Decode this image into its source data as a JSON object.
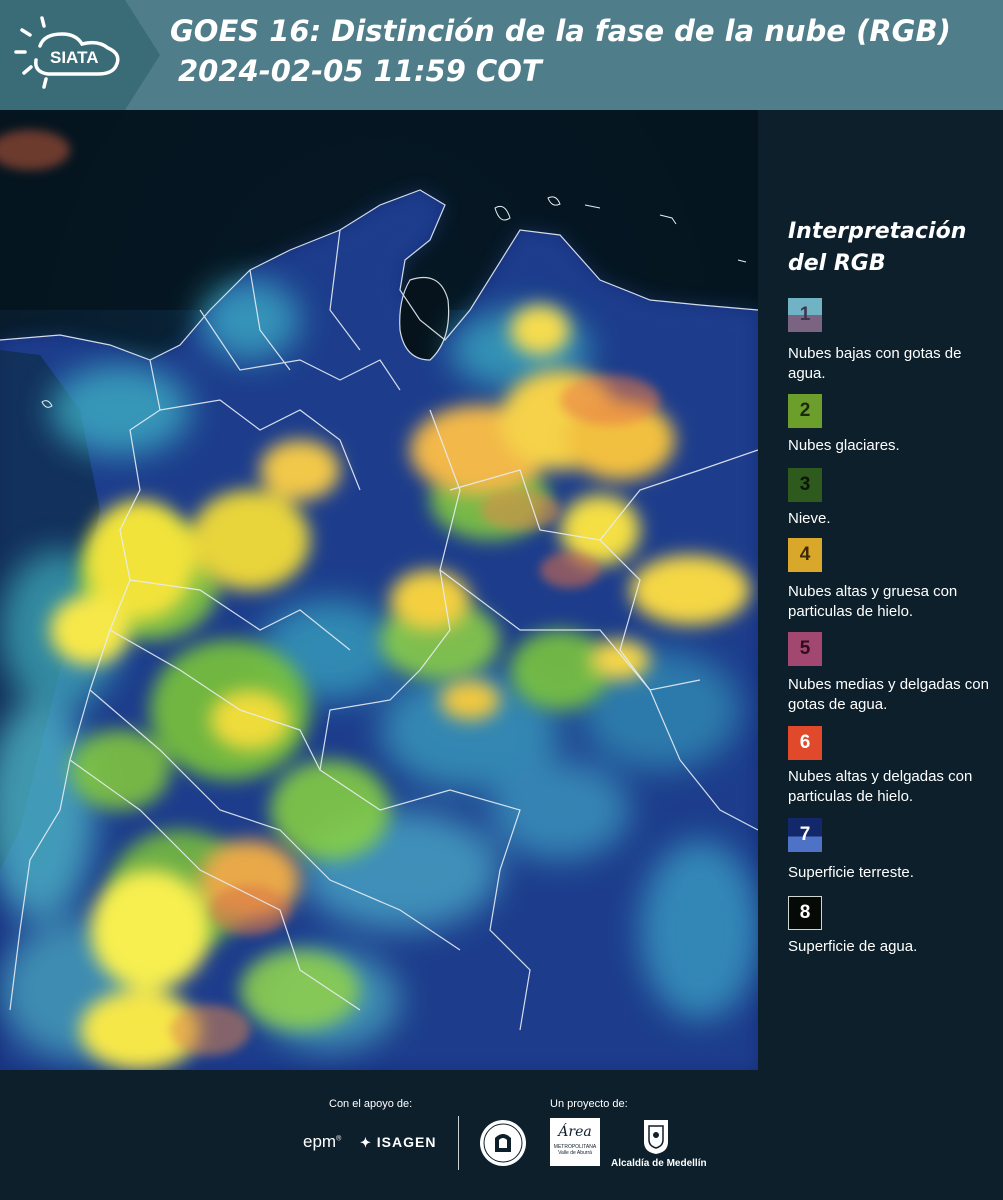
{
  "header": {
    "logo_text": "SIATA",
    "title_line1": "GOES 16: Distinción de la fase de la nube (RGB)",
    "title_line2": "2024-02-05 11:59 COT"
  },
  "legend": {
    "title": "Interpretación del RGB",
    "items": [
      {
        "number": "1",
        "label": "Nubes bajas con gotas de agua.",
        "color_top": "#6fb3c4",
        "color_bottom": "#7a6482"
      },
      {
        "number": "2",
        "label": "Nubes glaciares.",
        "color": "#6c9e2b"
      },
      {
        "number": "3",
        "label": "Nieve.",
        "color": "#2e5a1d"
      },
      {
        "number": "4",
        "label": "Nubes altas y gruesa con particulas de hielo.",
        "color": "#d9a82a"
      },
      {
        "number": "5",
        "label": "Nubes medias y delgadas con gotas de agua.",
        "color": "#a2476f"
      },
      {
        "number": "6",
        "label": "Nubes altas y delgadas con particulas de hielo.",
        "color": "#e04a2a"
      },
      {
        "number": "7",
        "label": "Superficie terreste.",
        "color_top": "#13286a",
        "color_bottom": "#4e73c6"
      },
      {
        "number": "8",
        "label": "Superficie de agua.",
        "color": "#050a07"
      }
    ]
  },
  "footer": {
    "support_label": "Con el apoyo de:",
    "project_label": "Un proyecto de:",
    "sponsors": [
      "epm",
      "ISAGEN"
    ],
    "area_logo_text": "Área",
    "area_logo_subtext": "METROPOLITANA",
    "area_logo_subtext2": "Valle de Aburrá",
    "alcaldia_text": "Alcaldía de Medellín"
  },
  "colors": {
    "header_bg": "#4f7d8a",
    "page_bg": "#0c1f2b",
    "border_lines": "#ffffff"
  }
}
